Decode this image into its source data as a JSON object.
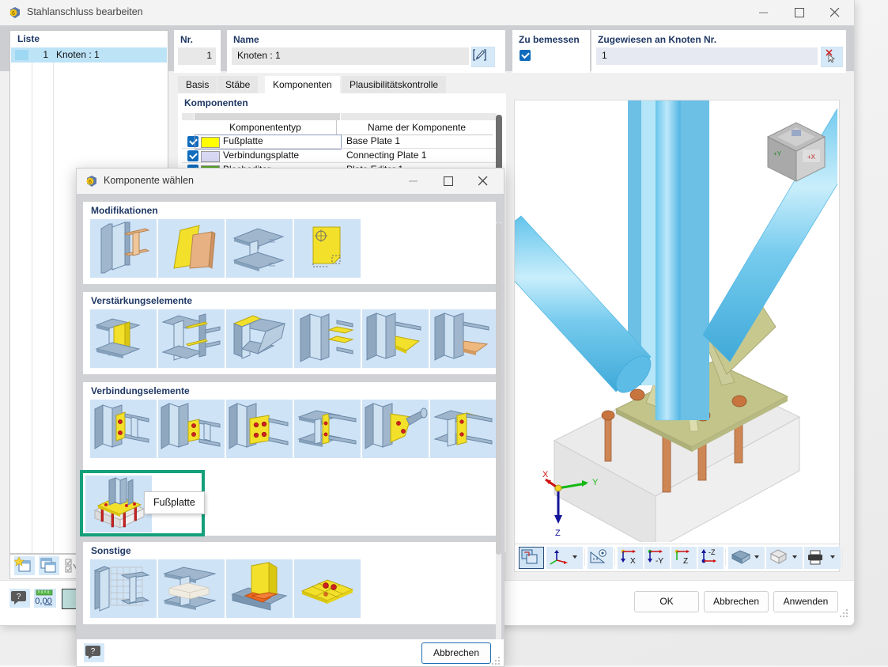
{
  "main_window": {
    "title": "Stahlanschluss bearbeiten",
    "icon": "app-logo-icon",
    "controls": {
      "minimize": "minimize-icon",
      "maximize": "maximize-icon",
      "close": "close-icon"
    },
    "liste": {
      "header": "Liste",
      "rows": [
        {
          "num": "1",
          "text": "Knoten : 1",
          "color": "#9fd8f2"
        }
      ]
    },
    "nr": {
      "label": "Nr.",
      "value": "1"
    },
    "name": {
      "label": "Name",
      "value": "Knoten : 1",
      "edit_icon": "edit-pencil-icon"
    },
    "zu_bemessen": {
      "label": "Zu bemessen",
      "checked": true
    },
    "zugewiesen": {
      "label": "Zugewiesen an Knoten Nr.",
      "value": "1",
      "pick_icon": "pick-node-icon"
    },
    "tabs": [
      {
        "label": "Basis",
        "active": false
      },
      {
        "label": "Stäbe",
        "active": false
      },
      {
        "label": "Komponenten",
        "active": true
      },
      {
        "label": "Plausibilitätskontrolle",
        "active": false
      }
    ],
    "komponenten": {
      "header": "Komponenten",
      "columns": [
        "",
        "Komponententyp",
        "Name der Komponente"
      ],
      "rows": [
        {
          "checked": true,
          "color": "#ffff00",
          "type": "Fußplatte",
          "name": "Base Plate 1",
          "selected": true
        },
        {
          "checked": true,
          "color": "#d8d8f4",
          "type": "Verbindungsplatte",
          "name": "Connecting Plate 1",
          "selected": false
        },
        {
          "checked": true,
          "color": "#5aa828",
          "type": "Blecheditor",
          "name": "Plate Editor 1",
          "selected": false
        }
      ]
    },
    "viewport": {
      "axis_labels": {
        "x": "X",
        "y": "Y",
        "z": "Z"
      },
      "nav_cube": "view-cube-icon",
      "toolbar": [
        {
          "name": "render-mode-button",
          "icon": "render-mode-icon",
          "active": true
        },
        {
          "name": "coordinate-system-button",
          "icon": "axis-icon",
          "dropdown": true
        },
        {
          "name": "measure-button",
          "icon": "ruler-eye-icon"
        },
        {
          "name": "view-x-button",
          "icon": "view-x-icon"
        },
        {
          "name": "view-negy-button",
          "icon": "view-negy-icon"
        },
        {
          "name": "view-z-button",
          "icon": "view-z-icon"
        },
        {
          "name": "view-negz-button",
          "icon": "view-negz-icon"
        },
        {
          "name": "shading-button",
          "icon": "shading-icon",
          "dropdown": true
        },
        {
          "name": "wireframe-button",
          "icon": "cube-wire-icon",
          "dropdown": true
        },
        {
          "name": "print-button",
          "icon": "printer-icon",
          "dropdown": true
        },
        {
          "name": "zoom-reset-button",
          "icon": "zoom-cancel-icon"
        },
        {
          "name": "panel-toggle-button",
          "icon": "panel-toggle-icon"
        }
      ]
    },
    "list_toolbar": [
      {
        "name": "new-item-button",
        "icon": "new-window-icon"
      },
      {
        "name": "copy-item-button",
        "icon": "copy-window-icon"
      },
      {
        "name": "check-all-button",
        "icon": "check-list-icon"
      }
    ],
    "bottom_icons": [
      {
        "name": "help-button",
        "icon": "help-bubble-icon"
      },
      {
        "name": "units-button",
        "icon": "units-0-00-icon"
      },
      {
        "name": "color-swatch-button",
        "icon": "color-swatch-icon"
      }
    ],
    "buttons": {
      "ok": "OK",
      "cancel": "Abbrechen",
      "apply": "Anwenden"
    }
  },
  "dialog": {
    "title": "Komponente wählen",
    "icon": "app-logo-icon",
    "controls": {
      "minimize": "minimize-icon",
      "maximize": "maximize-icon",
      "close": "close-icon"
    },
    "groups": [
      {
        "header": "Modifikationen",
        "items": [
          {
            "name": "thumb-beam-cut",
            "kind": "beam-cut"
          },
          {
            "name": "thumb-plate-fold",
            "kind": "plate-fold"
          },
          {
            "name": "thumb-notch",
            "kind": "notch"
          },
          {
            "name": "thumb-plate-shape",
            "kind": "plate-shape"
          }
        ]
      },
      {
        "header": "Verstärkungselemente",
        "items": [
          {
            "name": "thumb-web-stiffener",
            "kind": "web-stiffener"
          },
          {
            "name": "thumb-double-stiffener",
            "kind": "double-stiffener"
          },
          {
            "name": "thumb-flange-plate",
            "kind": "flange-plate"
          },
          {
            "name": "thumb-rib-plates",
            "kind": "rib-plates"
          },
          {
            "name": "thumb-haunch",
            "kind": "haunch"
          },
          {
            "name": "thumb-gusset",
            "kind": "gusset"
          }
        ]
      },
      {
        "header": "Verbindungselemente",
        "items": [
          {
            "name": "thumb-end-plate",
            "kind": "end-plate"
          },
          {
            "name": "thumb-fin-plate",
            "kind": "fin-plate"
          },
          {
            "name": "thumb-bolted-plate",
            "kind": "bolted-plate"
          },
          {
            "name": "thumb-splice-plate",
            "kind": "splice-plate"
          },
          {
            "name": "thumb-tube-gusset",
            "kind": "tube-gusset"
          },
          {
            "name": "thumb-angle-cleat",
            "kind": "angle-cleat"
          }
        ]
      },
      {
        "header": "Sonstige",
        "items": [
          {
            "name": "thumb-mesh-wall",
            "kind": "mesh-wall"
          },
          {
            "name": "thumb-mesh-block",
            "kind": "mesh-block"
          },
          {
            "name": "thumb-weld-seam",
            "kind": "weld-seam"
          },
          {
            "name": "thumb-bolt-grid",
            "kind": "bolt-grid"
          }
        ]
      }
    ],
    "selected": {
      "name": "thumb-base-plate",
      "tooltip": "Fußplatte"
    },
    "help_icon": "help-bubble-icon",
    "cancel_button": "Abbrechen"
  }
}
